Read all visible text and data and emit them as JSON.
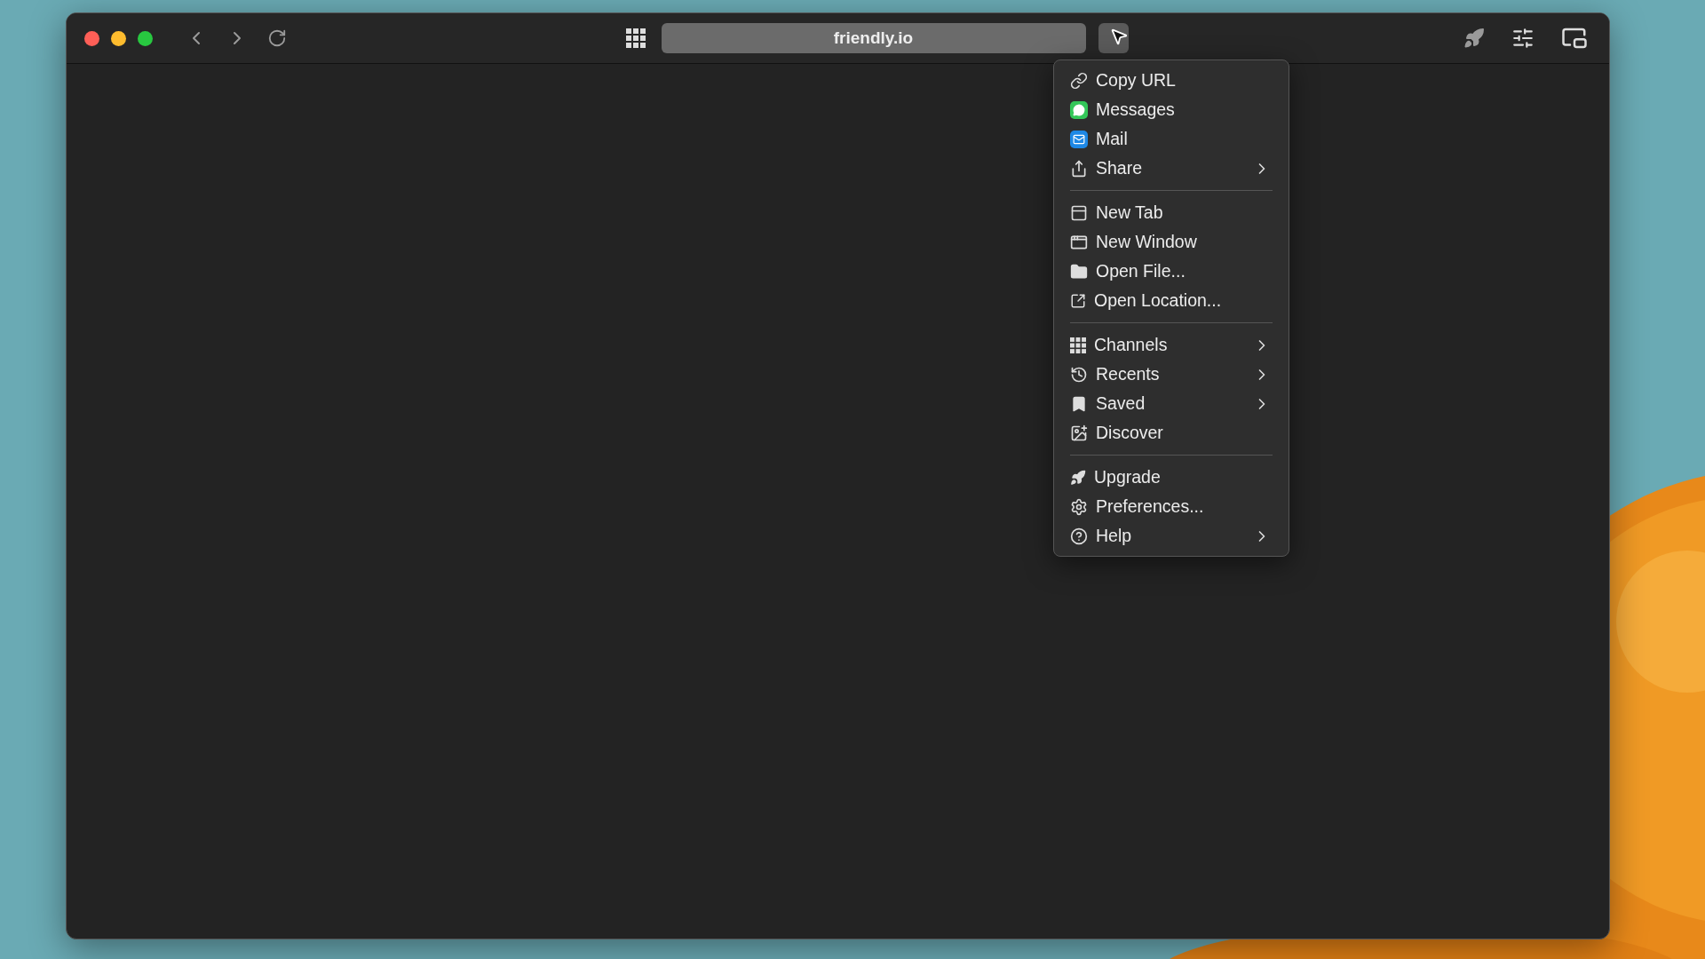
{
  "toolbar": {
    "address": "friendly.io",
    "menu_open": true
  },
  "menu": {
    "sections": [
      [
        {
          "label": "Copy URL",
          "submenu": false
        },
        {
          "label": "Messages",
          "submenu": false
        },
        {
          "label": "Mail",
          "submenu": false
        },
        {
          "label": "Share",
          "submenu": true
        }
      ],
      [
        {
          "label": "New Tab",
          "submenu": false
        },
        {
          "label": "New Window",
          "submenu": false
        },
        {
          "label": "Open File...",
          "submenu": false
        },
        {
          "label": "Open Location...",
          "submenu": false
        }
      ],
      [
        {
          "label": "Channels",
          "submenu": true
        },
        {
          "label": "Recents",
          "submenu": true
        },
        {
          "label": "Saved",
          "submenu": true
        },
        {
          "label": "Discover",
          "submenu": false
        }
      ],
      [
        {
          "label": "Upgrade",
          "submenu": false
        },
        {
          "label": "Preferences...",
          "submenu": false
        },
        {
          "label": "Help",
          "submenu": true
        }
      ]
    ]
  }
}
